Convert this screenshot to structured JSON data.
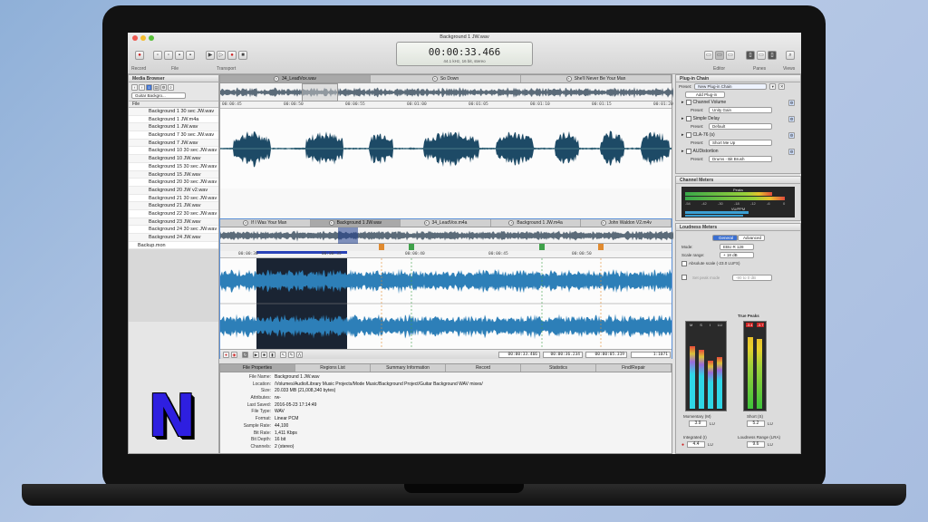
{
  "window": {
    "title": "Background 1 JW.wav"
  },
  "transport": {
    "time": "00:00:33.466",
    "format": "44.1 kHz, 16 bit, stereo"
  },
  "toolbar_groups": [
    "Record",
    "File",
    "Transport",
    "Editor",
    "Panes",
    "Views"
  ],
  "media_browser": {
    "title": "Media Browser",
    "folder": "Guitar Backgro...",
    "column": "File",
    "files": [
      "Background 1 30 sec JW.wav",
      "Background 1 JW.m4a",
      "Background 1 JW.wav",
      "Background 7 30 sec JW.wav",
      "Background 7 JW.wav",
      "Background 10 30 sec JW.wav",
      "Background 10 JW.wav",
      "Background 15 30 sec JW.wav",
      "Background 15 JW.wav",
      "Background 20 30 sec JW.wav",
      "Background 20 JW v2.wav",
      "Background 21 30 sec JW.wav",
      "Background 21 JW.wav",
      "Background 22 30 sec JW.wav",
      "Background 23 JW.wav",
      "Background 24 30 sec JW.wav",
      "Background 24 JW.wav",
      "Backup.mon"
    ]
  },
  "top_editor": {
    "tabs": [
      "34_LeadVox.wav",
      "So Down",
      "She'll Never Be Your Man"
    ],
    "ruler": [
      "00:00:45",
      "00:00:50",
      "00:00:55",
      "00:01:00",
      "00:01:05",
      "00:01:10",
      "00:01:15",
      "00:01:20"
    ],
    "tc_start": "00:00:00.000",
    "tc_end": "00:04:10.205",
    "zoom": "1:1538"
  },
  "bottom_editor": {
    "tabs": [
      "If I Was Your Man",
      "Background 1 JW.wav",
      "34_LeadVox.m4a",
      "Background 1 JW.m4a",
      "John Waldon V2.m4v"
    ],
    "ruler": [
      "00:00:30",
      "00:00:35",
      "00:00:40",
      "00:00:45",
      "00:00:50"
    ],
    "tc_start": "00:00:33.466",
    "tc_mid": "00:00:36.234",
    "tc_end": "00:00:05.319",
    "zoom": "1:1071"
  },
  "file_properties": {
    "tabs": [
      "File Properties",
      "Regions List",
      "Summary Information",
      "Record",
      "Statistics",
      "Find/Repair"
    ],
    "rows": [
      {
        "k": "File Name:",
        "v": "Background 1 JW.wav"
      },
      {
        "k": "Location:",
        "v": "/Volumes/Audio/Library Music Projects/Mode Music/Background Project/Guitar Background WAV mixes/"
      },
      {
        "k": "Size:",
        "v": "20.033 MB (21,008,340 bytes)"
      },
      {
        "k": "Attributes:",
        "v": "rw-"
      },
      {
        "k": "Last Saved:",
        "v": "2016-05-23 17:14:49"
      },
      {
        "k": "File Type:",
        "v": "WAV"
      },
      {
        "k": "Format:",
        "v": "Linear PCM"
      },
      {
        "k": "Sample Rate:",
        "v": "44,100"
      },
      {
        "k": "Bit Rate:",
        "v": "1,411 Kbps"
      },
      {
        "k": "Bit Depth:",
        "v": "16 bit"
      },
      {
        "k": "Channels:",
        "v": "2 (stereo)"
      }
    ]
  },
  "plugin_chain": {
    "title": "Plug-in Chain",
    "preset_label": "Preset:",
    "preset_value": "New Plug-in Chain",
    "add_label": "Add Plug-in",
    "plugins": [
      {
        "name": "Channel Volume",
        "preset": "Unity Gain"
      },
      {
        "name": "Simple Delay",
        "preset": "Default"
      },
      {
        "name": "CLA-76 (s)",
        "preset": "Short Me Up"
      },
      {
        "name": "AUDistortion",
        "preset": "Drums - Bit Brush"
      }
    ]
  },
  "channel_meters": {
    "title": "Channel Meters",
    "peaks_label": "Peaks",
    "vu_label": "VU/PPM",
    "scale": [
      "-54",
      "-42",
      "-30",
      "-18",
      "-12",
      "-6",
      "0"
    ]
  },
  "loudness": {
    "title": "Loudness Meters",
    "tabs": [
      "General",
      "Advanced"
    ],
    "mode_label": "Mode:",
    "mode_value": "EBU R 128",
    "scale_label": "Scale range:",
    "scale_value": "+ 18 dB",
    "absolute_label": "Absolute scale (-23.0 LUFS)",
    "peak_label": "Set peak mode",
    "peak_value": "-90 to 0 dB",
    "true_peaks_title": "True Peaks",
    "tp_left": "-3.4",
    "tp_right": "-3.7",
    "col_labels": [
      "M",
      "S",
      "I",
      "LU"
    ],
    "momentary_label": "Momentary (M)",
    "momentary_value": "3.9",
    "short_label": "Short (S)",
    "short_value": "5.2",
    "integrated_label": "Integrated (I)",
    "integrated_value": "4.4",
    "lra_label": "Loudness Range (LRA)",
    "lra_value": "9.6",
    "unit": "LU",
    "levels": {
      "m": 0.78,
      "s": 0.74,
      "i": 0.6,
      "lu": 0.65,
      "tp_l": 0.9,
      "tp_r": 0.88
    }
  },
  "brand": {
    "letter": "N"
  }
}
